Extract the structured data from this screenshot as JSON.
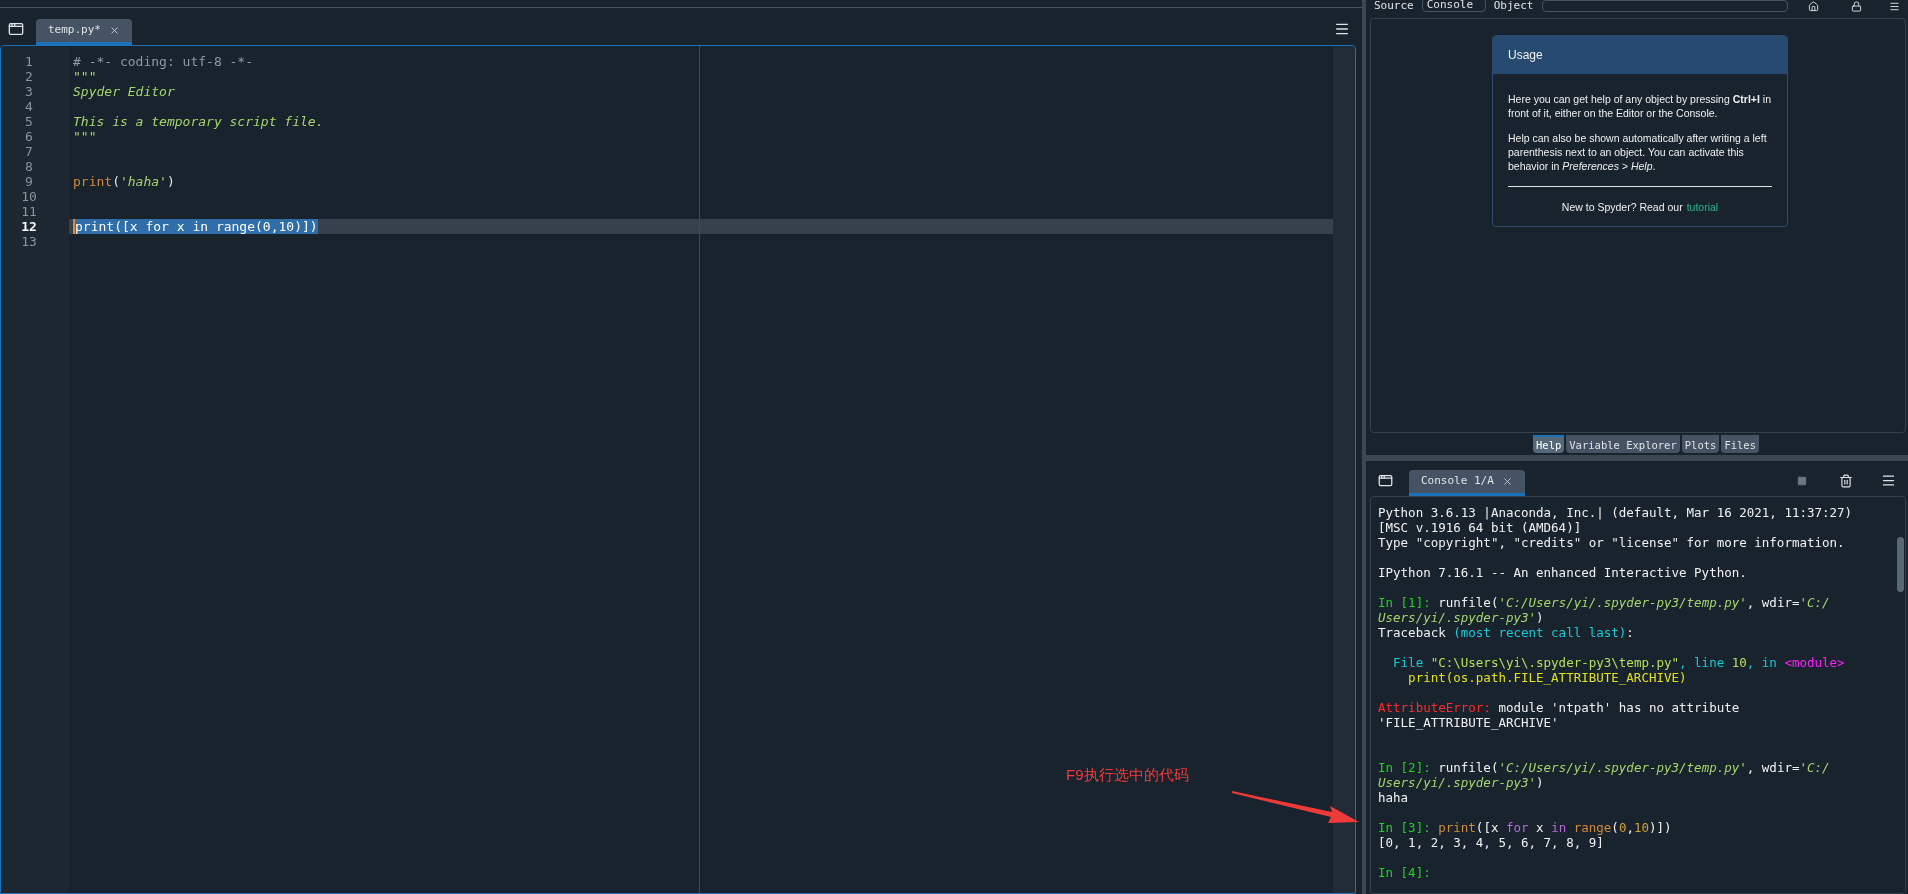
{
  "editor": {
    "tabs": [
      {
        "label": "temp.py*",
        "selected": true
      }
    ],
    "lines": [
      {
        "number": "1",
        "selected": false,
        "segments": [
          {
            "text": "# -*- coding: utf-8 -*-",
            "kind": "comment"
          }
        ]
      },
      {
        "number": "2",
        "selected": false,
        "segments": [
          {
            "text": "\"\"\"",
            "kind": "docstring"
          }
        ]
      },
      {
        "number": "3",
        "selected": false,
        "segments": [
          {
            "text": "Spyder Editor",
            "kind": "docstring"
          }
        ]
      },
      {
        "number": "4",
        "selected": false
      },
      {
        "number": "5",
        "selected": false,
        "segments": [
          {
            "text": "This is a temporary script file.",
            "kind": "docstring"
          }
        ]
      },
      {
        "number": "6",
        "selected": false,
        "segments": [
          {
            "text": "\"\"\"",
            "kind": "docstring"
          }
        ]
      },
      {
        "number": "7",
        "selected": false
      },
      {
        "number": "8",
        "selected": false
      },
      {
        "number": "9",
        "selected": false,
        "segments": [
          {
            "text": "print",
            "kind": "builtin"
          },
          {
            "text": "(",
            "kind": "plain"
          },
          {
            "text": "'haha'",
            "kind": "string"
          },
          {
            "text": ")",
            "kind": "plain"
          }
        ]
      },
      {
        "number": "10",
        "selected": false
      },
      {
        "number": "11",
        "selected": false
      },
      {
        "number": "12",
        "selected": true,
        "segments": [
          {
            "text": "print([x for x in range(0,10)])",
            "kind": "plain"
          }
        ]
      },
      {
        "number": "13",
        "selected": false
      }
    ]
  },
  "help": {
    "source_label": "Source",
    "source_value": "Console",
    "object_label": "Object",
    "usage": {
      "title": "Usage",
      "paragraphs": [
        "Here you can get help of any object by pressing **Ctrl+I** in front of it, either on the Editor or the Console.",
        "Help can also be shown automatically after writing a left parenthesis next to an object. You can activate this behavior in *Preferences > Help*."
      ],
      "footer": "New to Spyder? Read our",
      "link": "tutorial"
    },
    "tabs": [
      {
        "label": "Help",
        "selected": true
      },
      {
        "label": "Variable Explorer",
        "selected": false
      },
      {
        "label": "Plots",
        "selected": false
      },
      {
        "label": "Files",
        "selected": false
      }
    ]
  },
  "console": {
    "tabs": [
      {
        "label": "Console 1/A",
        "selected": true
      }
    ],
    "lines": [
      {
        "kind": "text",
        "segments": [
          {
            "text": "Python 3.6.13 |Anaconda, Inc.| (default, Mar 16 2021, 11:37:27)",
            "kind": "plain"
          }
        ]
      },
      {
        "kind": "text",
        "segments": [
          {
            "text": "[MSC v.1916 64 bit (AMD64)]",
            "kind": "plain"
          }
        ]
      },
      {
        "kind": "text",
        "segments": [
          {
            "text": "Type \"copyright\", \"credits\" or \"license\" for more information.",
            "kind": "plain"
          }
        ]
      },
      {
        "kind": "blank"
      },
      {
        "kind": "text",
        "segments": [
          {
            "text": "IPython 7.16.1 -- An enhanced Interactive Python.",
            "kind": "plain"
          }
        ]
      },
      {
        "kind": "blank"
      },
      {
        "kind": "text",
        "segments": [
          {
            "text": "In [1]: ",
            "kind": "prompt"
          },
          {
            "text": "runfile(",
            "kind": "plain"
          },
          {
            "text": "'C:/Users/yi/.spyder-py3/temp.py'",
            "kind": "string"
          },
          {
            "text": ", wdir=",
            "kind": "plain"
          },
          {
            "text": "'C:/",
            "kind": "string"
          }
        ]
      },
      {
        "kind": "text",
        "segments": [
          {
            "text": "Users/yi/.spyder-py3'",
            "kind": "string"
          },
          {
            "text": ")",
            "kind": "plain"
          }
        ]
      },
      {
        "kind": "text",
        "segments": [
          {
            "text": "Traceback ",
            "kind": "plain"
          },
          {
            "text": "(most recent call last)",
            "kind": "cyan"
          },
          {
            "text": ":",
            "kind": "plain"
          }
        ]
      },
      {
        "kind": "blank"
      },
      {
        "kind": "text",
        "segments": [
          {
            "text": "  File ",
            "kind": "cyan"
          },
          {
            "text": "\"C:\\Users\\yi\\.spyder-py3\\temp.py\"",
            "kind": "path"
          },
          {
            "text": ", line ",
            "kind": "cyan"
          },
          {
            "text": "10",
            "kind": "path"
          },
          {
            "text": ", in ",
            "kind": "cyan"
          },
          {
            "text": "<module>",
            "kind": "magenta"
          }
        ]
      },
      {
        "kind": "text",
        "segments": [
          {
            "text": "    print(os.path.FILE_ATTRIBUTE_ARCHIVE)",
            "kind": "yellow"
          }
        ]
      },
      {
        "kind": "blank"
      },
      {
        "kind": "text",
        "segments": [
          {
            "text": "AttributeError:",
            "kind": "error"
          },
          {
            "text": " module 'ntpath' has no attribute",
            "kind": "plain"
          }
        ]
      },
      {
        "kind": "text",
        "segments": [
          {
            "text": "'FILE_ATTRIBUTE_ARCHIVE'",
            "kind": "plain"
          }
        ]
      },
      {
        "kind": "blank"
      },
      {
        "kind": "blank"
      },
      {
        "kind": "text",
        "segments": [
          {
            "text": "In [2]: ",
            "kind": "prompt"
          },
          {
            "text": "runfile(",
            "kind": "plain"
          },
          {
            "text": "'C:/Users/yi/.spyder-py3/temp.py'",
            "kind": "string"
          },
          {
            "text": ", wdir=",
            "kind": "plain"
          },
          {
            "text": "'C:/",
            "kind": "string"
          }
        ]
      },
      {
        "kind": "text",
        "segments": [
          {
            "text": "Users/yi/.spyder-py3'",
            "kind": "string"
          },
          {
            "text": ")",
            "kind": "plain"
          }
        ]
      },
      {
        "kind": "text",
        "segments": [
          {
            "text": "haha",
            "kind": "plain"
          }
        ]
      },
      {
        "kind": "blank"
      },
      {
        "kind": "text",
        "segments": [
          {
            "text": "In [3]: ",
            "kind": "prompt"
          },
          {
            "text": "print",
            "kind": "builtin"
          },
          {
            "text": "([x ",
            "kind": "plain"
          },
          {
            "text": "for",
            "kind": "keyword"
          },
          {
            "text": " x ",
            "kind": "plain"
          },
          {
            "text": "in",
            "kind": "keyword"
          },
          {
            "text": " range",
            "kind": "builtin"
          },
          {
            "text": "(",
            "kind": "plain"
          },
          {
            "text": "0",
            "kind": "number"
          },
          {
            "text": ",",
            "kind": "plain"
          },
          {
            "text": "10",
            "kind": "number"
          },
          {
            "text": ")])",
            "kind": "plain"
          }
        ]
      },
      {
        "kind": "text",
        "segments": [
          {
            "text": "[0, 1, 2, 3, 4, 5, 6, 7, 8, 9]",
            "kind": "plain"
          }
        ]
      },
      {
        "kind": "blank"
      },
      {
        "kind": "text",
        "segments": [
          {
            "text": "In [4]:",
            "kind": "prompt"
          }
        ]
      }
    ]
  },
  "annotation": {
    "text": "F9执行选中的代码"
  }
}
